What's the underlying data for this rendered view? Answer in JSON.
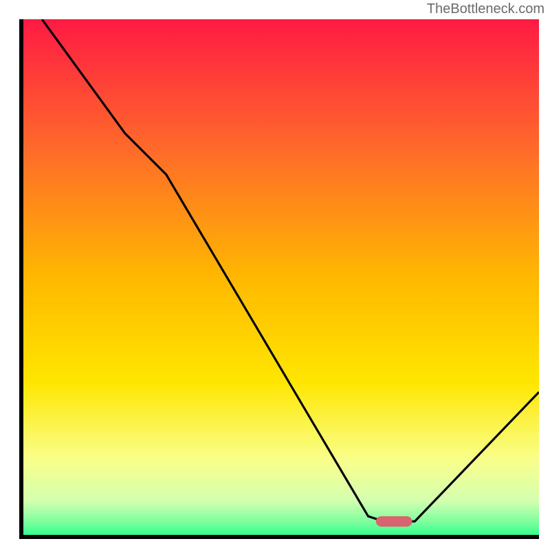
{
  "watermark": "TheBottleneck.com",
  "chart_data": {
    "type": "line",
    "title": "",
    "xlabel": "",
    "ylabel": "",
    "xlim": [
      0,
      100
    ],
    "ylim": [
      0,
      100
    ],
    "gradient_stops": [
      {
        "offset": 0,
        "color": "#ff1a44"
      },
      {
        "offset": 25,
        "color": "#ff6a2a"
      },
      {
        "offset": 50,
        "color": "#ffb800"
      },
      {
        "offset": 70,
        "color": "#ffe600"
      },
      {
        "offset": 85,
        "color": "#f9ff8a"
      },
      {
        "offset": 93,
        "color": "#d4ffb0"
      },
      {
        "offset": 97,
        "color": "#7fff9e"
      },
      {
        "offset": 100,
        "color": "#2aff8a"
      }
    ],
    "curve": [
      {
        "x": 4,
        "y": 100
      },
      {
        "x": 20,
        "y": 78
      },
      {
        "x": 28,
        "y": 70
      },
      {
        "x": 67,
        "y": 4
      },
      {
        "x": 70,
        "y": 3
      },
      {
        "x": 76,
        "y": 3
      },
      {
        "x": 100,
        "y": 28
      }
    ],
    "marker": {
      "x": 72,
      "y": 3,
      "width": 7,
      "height": 2,
      "color": "#d9636f"
    },
    "axis_color": "#000000"
  }
}
